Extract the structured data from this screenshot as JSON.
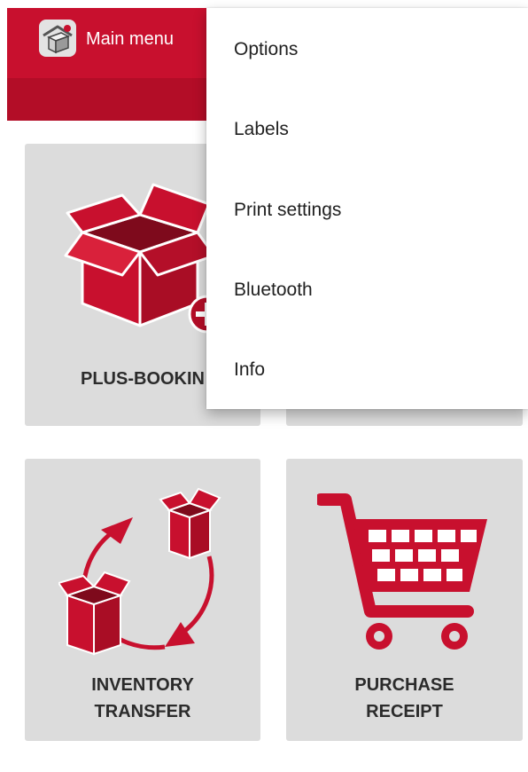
{
  "header": {
    "title": "Main menu",
    "app_icon": "warehouse-box-icon",
    "bar_color": "#c8102e"
  },
  "tiles": [
    {
      "label": "PLUS-BOOKIN",
      "icon": "open-box-plus-icon"
    },
    {
      "label": "",
      "icon": ""
    },
    {
      "label": "INVENTORY TRANSFER",
      "line1": "INVENTORY",
      "line2": "TRANSFER",
      "icon": "box-transfer-cycle-icon"
    },
    {
      "label": "PURCHASE RECEIPT",
      "line1": "PURCHASE",
      "line2": "RECEIPT",
      "icon": "shopping-cart-icon"
    }
  ],
  "menu": {
    "items": [
      {
        "label": "Options"
      },
      {
        "label": "Labels"
      },
      {
        "label": "Print settings"
      },
      {
        "label": "Bluetooth"
      },
      {
        "label": "Info"
      }
    ]
  },
  "colors": {
    "accent": "#c8102e",
    "tile_bg": "#dcdcdc"
  }
}
